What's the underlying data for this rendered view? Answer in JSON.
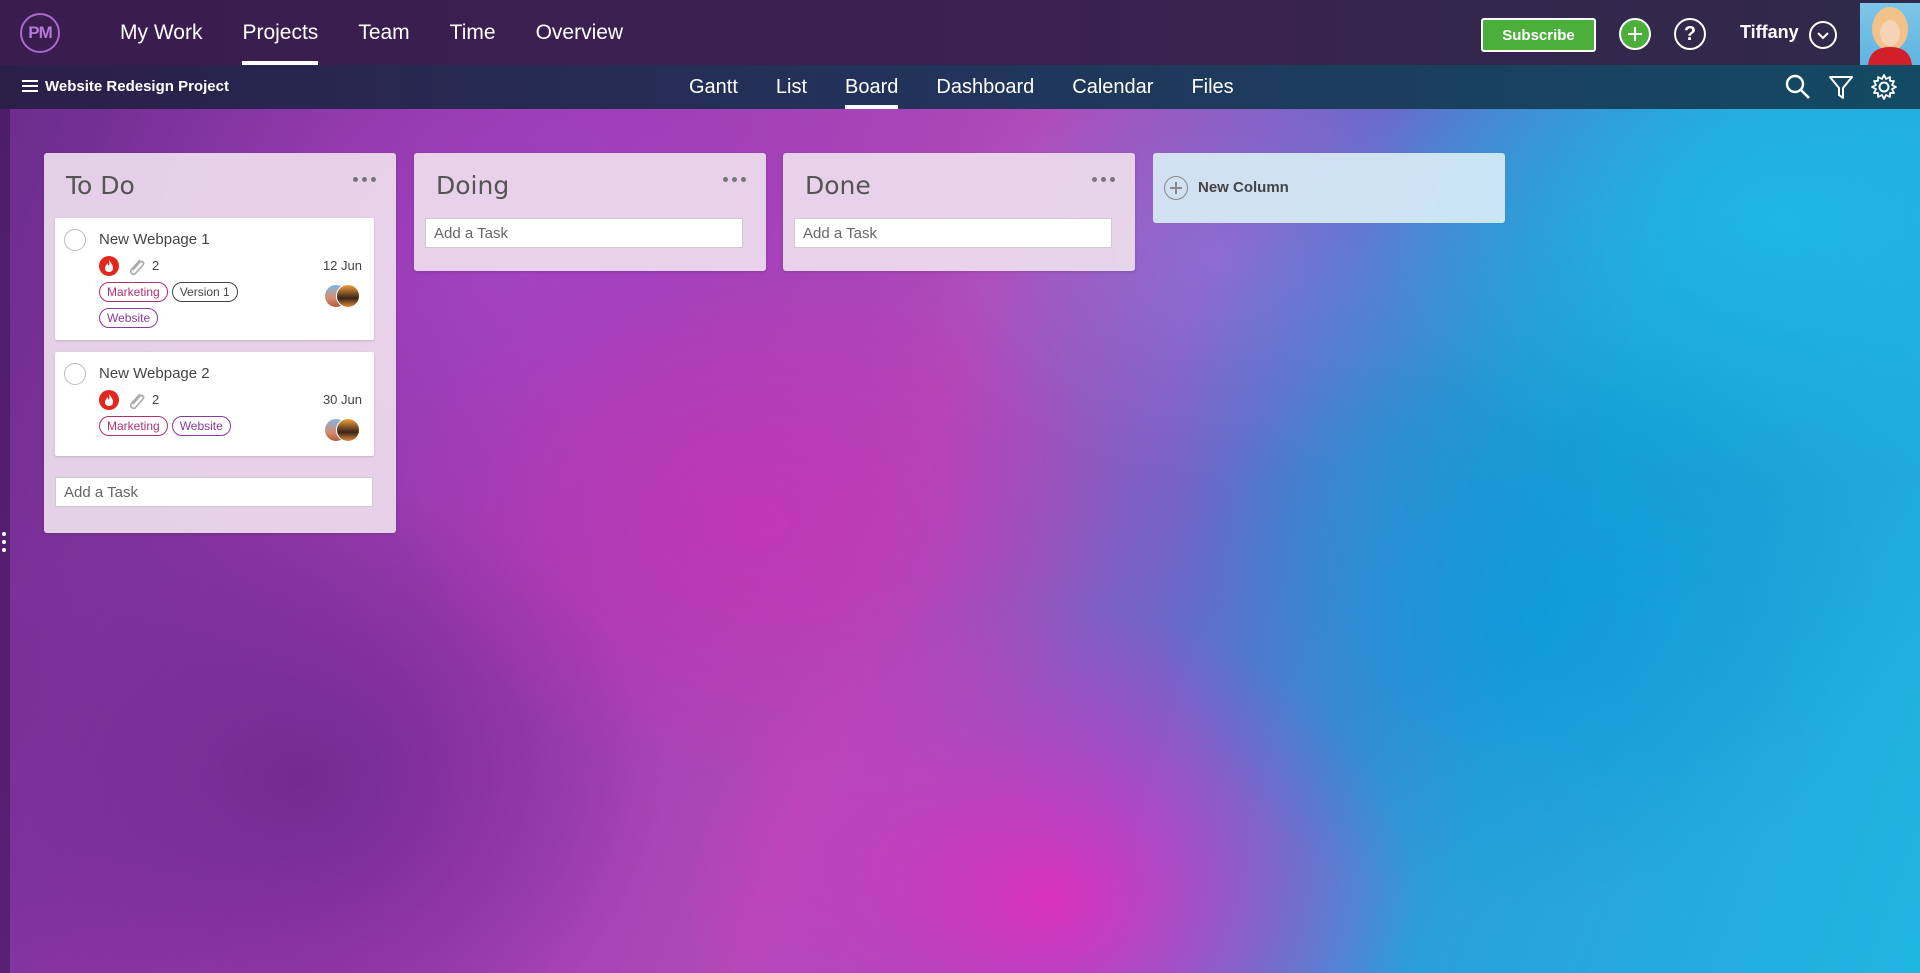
{
  "app": {
    "logo_text": "PM"
  },
  "main_nav": {
    "items": [
      {
        "label": "My Work",
        "active": false
      },
      {
        "label": "Projects",
        "active": true
      },
      {
        "label": "Team",
        "active": false
      },
      {
        "label": "Time",
        "active": false
      },
      {
        "label": "Overview",
        "active": false
      }
    ]
  },
  "header_right": {
    "subscribe_label": "Subscribe",
    "user_name": "Tiffany",
    "plus_icon": "plus-icon",
    "help_icon": "question-icon",
    "help_glyph": "?"
  },
  "project": {
    "name": "Website Redesign Project"
  },
  "view_nav": {
    "items": [
      {
        "label": "Gantt",
        "active": false
      },
      {
        "label": "List",
        "active": false
      },
      {
        "label": "Board",
        "active": true
      },
      {
        "label": "Dashboard",
        "active": false
      },
      {
        "label": "Calendar",
        "active": false
      },
      {
        "label": "Files",
        "active": false
      }
    ]
  },
  "board": {
    "add_task_placeholder": "Add a Task",
    "new_column_label": "New Column",
    "columns": [
      {
        "title": "To Do",
        "cards": [
          {
            "title": "New Webpage 1",
            "priority_icon": "fire-icon",
            "attachments": "2",
            "due": "12 Jun",
            "tags": [
              {
                "label": "Marketing",
                "color": "#b0306f"
              },
              {
                "label": "Version 1",
                "color": "#444444"
              },
              {
                "label": "Website",
                "color": "#8a3a9a"
              }
            ]
          },
          {
            "title": "New Webpage 2",
            "priority_icon": "fire-icon",
            "attachments": "2",
            "due": "30 Jun",
            "tags": [
              {
                "label": "Marketing",
                "color": "#b0306f"
              },
              {
                "label": "Website",
                "color": "#8a3a9a"
              }
            ]
          }
        ]
      },
      {
        "title": "Doing",
        "cards": []
      },
      {
        "title": "Done",
        "cards": []
      }
    ]
  },
  "colors": {
    "subscribe_green": "#4caf3c",
    "priority_red": "#e3261e",
    "topbar": "#3a1c4e"
  }
}
